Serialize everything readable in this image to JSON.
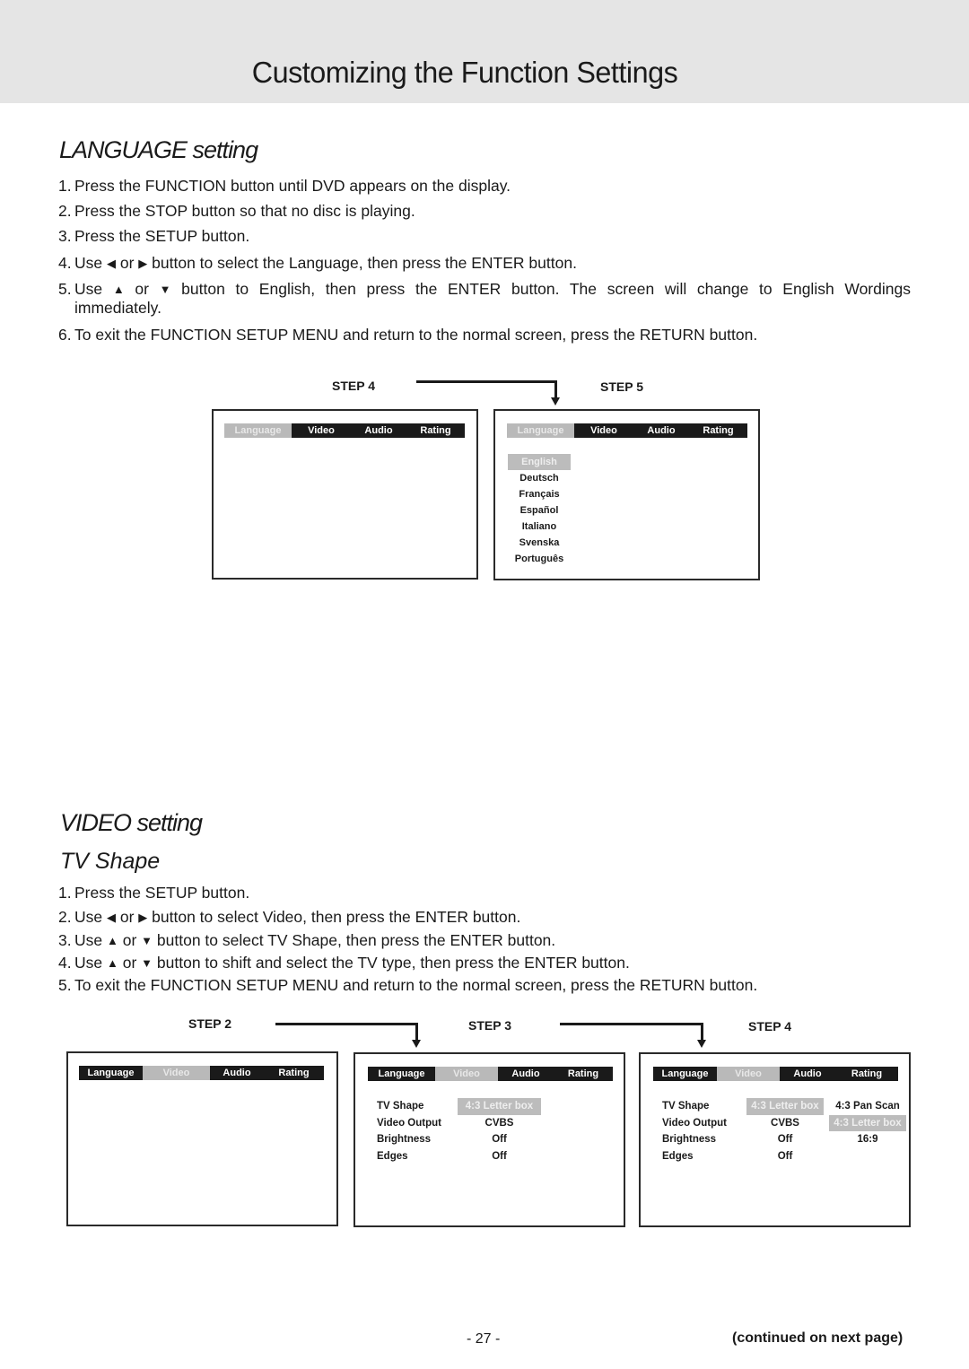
{
  "page": {
    "title": "Customizing the Function Settings",
    "page_number": "- 27 -",
    "continued": "(continued on next page)"
  },
  "language_section": {
    "title": "LANGUAGE setting",
    "steps": [
      {
        "num": "1.",
        "parts": [
          "Press the FUNCTION button until DVD appears on the display."
        ]
      },
      {
        "num": "2.",
        "parts": [
          "Press the STOP button so that no disc is playing."
        ]
      },
      {
        "num": "3.",
        "parts": [
          "Press the SETUP button."
        ]
      },
      {
        "num": "4.",
        "parts": [
          "Use ",
          "or",
          " button to select the Language, then press the ENTER button."
        ]
      },
      {
        "num": "5.",
        "parts": [
          "Use ",
          "or",
          " button to English, then press the ENTER button. The screen will change to English Wordings immediately."
        ]
      },
      {
        "num": "6.",
        "parts": [
          "To exit the FUNCTION SETUP MENU and return to the normal screen, press the RETURN button."
        ]
      }
    ],
    "icons": {
      "left": "◀",
      "right": "▶",
      "up": "▲",
      "down": "▼"
    },
    "diagram": {
      "step_a_label": "STEP 4",
      "step_b_label": "STEP 5",
      "tabs": [
        "Language",
        "Video",
        "Audio",
        "Rating"
      ],
      "active_tab": "Language",
      "languages": [
        "English",
        "Deutsch",
        "Français",
        "Español",
        "Italiano",
        "Svenska",
        "Português"
      ],
      "selected_language": "English"
    }
  },
  "video_section": {
    "title": "VIDEO setting",
    "subtitle": "TV Shape",
    "steps": [
      {
        "num": "1.",
        "parts": [
          "Press the SETUP button."
        ]
      },
      {
        "num": "2.",
        "parts": [
          "Use ",
          "or",
          " button to select Video, then press the ENTER button."
        ]
      },
      {
        "num": "3.",
        "parts": [
          "Use ",
          "or",
          " button to select TV Shape, then press the ENTER button."
        ]
      },
      {
        "num": "4.",
        "parts": [
          "Use ",
          "or",
          " button to shift and select the TV type, then press the ENTER button."
        ]
      },
      {
        "num": "5.",
        "parts": [
          "To exit the FUNCTION SETUP MENU and return to the normal screen, press the RETURN button."
        ]
      }
    ],
    "diagram": {
      "step_a_label": "STEP 2",
      "step_b_label": "STEP 3",
      "step_c_label": "STEP 4",
      "tabs": [
        "Language",
        "Video",
        "Audio",
        "Rating"
      ],
      "active_tab": "Video",
      "settings": [
        {
          "label": "TV Shape",
          "value": "4:3 Letter box"
        },
        {
          "label": "Video Output",
          "value": "CVBS"
        },
        {
          "label": "Brightness",
          "value": "Off"
        },
        {
          "label": "Edges",
          "value": "Off"
        }
      ],
      "tv_shape_options": [
        "4:3 Pan Scan",
        "4:3 Letter box",
        "16:9"
      ],
      "selected_option": "4:3 Letter box"
    }
  }
}
